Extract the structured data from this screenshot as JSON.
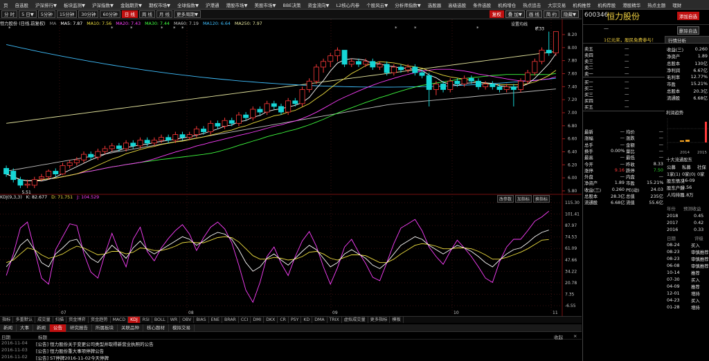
{
  "menu": [
    "页",
    "自选股",
    "沪深排行▼",
    "板块监测▼",
    "沪深指数▼",
    "金融期货▼",
    "期权市场▼",
    "全球指数▼",
    "沪港通",
    "港股市场▼",
    "美股市场▼",
    "BBE决策",
    "资金流向▼",
    "L2核心内参",
    "个股风云▼",
    "分析师指数▼",
    "选股器",
    "高级选股",
    "条件选股",
    "机构增仓",
    "热点追击",
    "大宗交易",
    "机构推荐",
    "机构荐股",
    "港股精华",
    "热点主题",
    "理财"
  ],
  "periods": [
    "分 时",
    "5 日▼",
    "5分钟",
    "15分钟",
    "30分钟",
    "60分钟",
    "日 线",
    "周 线",
    "月 线",
    "更多周期▼"
  ],
  "period_active": "日 线",
  "toolbar_right": [
    "复权",
    "叠 加▼",
    "画 线",
    "简 约",
    "隐藏▼"
  ],
  "ma_legend": {
    "name": "恒力股份 (日线,前复权)",
    "ma": "MA",
    "ma5": "MA5: 7.87",
    "ma10": "MA10: 7.56",
    "ma20": "MA20: 7.43",
    "ma30": "MA30: 7.44",
    "ma60": "MA60: 7.19",
    "ma120": "MA120: 6.64",
    "ma250": "MA250: 7.97"
  },
  "kdj_legend": {
    "name": "KDJ(9,3,3)",
    "k": "K: 82.677",
    "d": "D: 71.751",
    "j": "J: 104.529"
  },
  "kdj_buttons": [
    "改参数",
    "加指标",
    "换指标"
  ],
  "price_axis": [
    "8.20",
    "8.00",
    "7.80",
    "7.60",
    "7.40",
    "7.20",
    "7.00",
    "6.80",
    "6.60",
    "6.40",
    "6.20",
    "6.00",
    "5.80"
  ],
  "kdj_axis": [
    "115.30",
    "101.41",
    "87.97",
    "74.53",
    "61.09",
    "47.66",
    "34.22",
    "20.78",
    "7.35",
    "-6.55"
  ],
  "date_labels": [
    "07",
    "08",
    "09",
    "10",
    "11"
  ],
  "chart_labels": {
    "high": "8.33",
    "low": "5.51",
    "overlay": "设置均线",
    "star": "*"
  },
  "indicators": [
    "指标",
    "多重默认",
    "成交量",
    "扫描",
    "资金博弈",
    "资金趋势",
    "MACD",
    "KDJ",
    "RSI",
    "BOLL",
    "WR",
    "OBV",
    "BIAS",
    "ENE",
    "BRAR",
    "CCI",
    "DMI",
    "DKX",
    "CR",
    "PSY",
    "KD",
    "DMA",
    "TRIX",
    "虚拟成交量",
    "更多指标",
    "模板"
  ],
  "indicator_active": "KDJ",
  "tabs": [
    "新闻",
    "大事",
    "新闻",
    "公告",
    "研究报告",
    "所属板块",
    "关联品种",
    "核心题材",
    "模拟交易"
  ],
  "tab_active": "公告",
  "news_header": {
    "date": "日期",
    "title": "标题",
    "collapse": "收起",
    "close": "×"
  },
  "news": [
    {
      "date": "2016-11-04",
      "text": "[公告] 恒力股份关于变更公司类型并取得新营业执照的公告"
    },
    {
      "date": "2016-11-03",
      "text": "[公告] 恒力股份重大事项停牌公告"
    },
    {
      "date": "2016-11-02",
      "text": "[公告] ST停牌2016-11-02今天停牌"
    }
  ],
  "stock": {
    "code": "600346",
    "name": "恒力股份",
    "dash": "—",
    "btn_add": "添加自选",
    "btn_del": "删除自选",
    "btn_trade": "行情分析",
    "promo": "1亿元奖，股民免费参与！"
  },
  "order_book": {
    "sell": [
      "卖五",
      "卖四",
      "卖三",
      "卖二",
      "卖一"
    ],
    "buy": [
      "买一",
      "买二",
      "买三",
      "买四",
      "买五"
    ],
    "dash": "—"
  },
  "quote": [
    [
      "最新",
      "—",
      "均价",
      "—"
    ],
    [
      "涨幅",
      "—",
      "涨跌",
      "—"
    ],
    [
      "总手",
      "—",
      "金额",
      "—"
    ],
    [
      "换手",
      "0.00%",
      "量比",
      "—"
    ],
    [
      "最高",
      "—",
      "最低",
      "—"
    ],
    [
      "今开",
      "—",
      "昨收",
      "8.33"
    ],
    [
      "涨停",
      "9.16",
      "跌停",
      "7.50"
    ],
    [
      "外盘",
      "—",
      "内盘",
      "—"
    ],
    [
      "净资产",
      "1.89",
      "市盈",
      "15.21%"
    ],
    [
      "收益(三)",
      "0.260",
      "PE(动)",
      "24.03"
    ],
    [
      "总股本",
      "28.3亿",
      "总值",
      "235亿"
    ],
    [
      "流通股",
      "6.68亿",
      "流值",
      "55.6亿"
    ]
  ],
  "finance": [
    [
      "收益(三)",
      "0.260"
    ],
    [
      "净资产",
      "1.89"
    ],
    [
      "总股本",
      "130亿"
    ],
    [
      "净利润",
      "6.67亿"
    ],
    [
      "毛利率",
      "12.77%"
    ],
    [
      "市盈",
      "15.21%"
    ],
    [
      "总股本",
      "20.3亿"
    ],
    [
      "流通股",
      "6.68亿"
    ]
  ],
  "finance_extra": {
    "title": "利润趋势",
    "y1": "2014",
    "y2": "2015"
  },
  "holders_title": "十大流通股东",
  "holder_rows": [
    [
      "公募",
      "私募",
      "社保"
    ],
    [
      "1家(1)",
      "0家(0)",
      "0家"
    ],
    [
      "股东情况",
      "16-09",
      ""
    ],
    [
      "股东户数",
      "3.56",
      ""
    ],
    [
      "人均持股",
      "1.8万",
      ""
    ]
  ],
  "eps_head": [
    "年份",
    "预测收益"
  ],
  "eps": [
    [
      "2018",
      "0.45"
    ],
    [
      "2017",
      "0.42"
    ],
    [
      "2016",
      "0.33"
    ]
  ],
  "events_head": [
    "日期",
    "评级"
  ],
  "events": [
    [
      "08-24",
      "买入"
    ],
    [
      "08-23",
      "审慎推荐"
    ],
    [
      "08-23",
      "审慎推荐"
    ],
    [
      "06-08",
      "审慎推荐"
    ],
    [
      "10-14",
      "推荐"
    ],
    [
      "07-30",
      "买入"
    ],
    [
      "04-09",
      "推荐"
    ],
    [
      "12-01",
      "增持"
    ],
    [
      "04-23",
      "买入"
    ],
    [
      "01-28",
      "增持"
    ]
  ],
  "colors": {
    "up": "#ff3a3a",
    "down": "#16d6d6",
    "ma5": "#ffffff",
    "ma10": "#f0e040",
    "ma20": "#ff40ff",
    "ma30": "#40ff40",
    "ma60": "#c0c0c0",
    "ma120": "#40c0ff",
    "ma250": "#e8e8a0",
    "k": "#ffffff",
    "d": "#f0e040",
    "j": "#ff40ff"
  },
  "chart_data": {
    "type": "candlestick",
    "title": "恒力股份 (日线,前复权)",
    "ylim": [
      5.5,
      8.4
    ],
    "kdj_ylim": [
      -6.55,
      115.3
    ],
    "candles": [
      [
        5.9,
        5.8,
        5.95,
        5.75
      ],
      [
        5.85,
        5.7,
        5.9,
        5.65
      ],
      [
        5.7,
        5.6,
        5.75,
        5.55
      ],
      [
        5.6,
        5.62,
        5.7,
        5.55
      ],
      [
        5.6,
        5.7,
        5.75,
        5.55
      ],
      [
        5.72,
        5.75,
        5.8,
        5.68
      ],
      [
        5.75,
        5.85,
        5.88,
        5.7
      ],
      [
        5.85,
        5.8,
        5.9,
        5.75
      ],
      [
        5.8,
        5.95,
        6.0,
        5.78
      ],
      [
        5.95,
        6.0,
        6.05,
        5.9
      ],
      [
        6.0,
        6.05,
        6.1,
        5.95
      ],
      [
        6.05,
        6.15,
        6.2,
        6.0
      ],
      [
        6.15,
        6.1,
        6.2,
        6.05
      ],
      [
        6.1,
        6.2,
        6.25,
        6.05
      ],
      [
        6.2,
        6.25,
        6.3,
        6.15
      ],
      [
        6.25,
        6.3,
        6.35,
        6.2
      ],
      [
        6.3,
        6.25,
        6.35,
        6.2
      ],
      [
        6.25,
        6.35,
        6.4,
        6.2
      ],
      [
        6.35,
        6.3,
        6.4,
        6.25
      ],
      [
        6.3,
        6.4,
        6.45,
        6.25
      ],
      [
        6.4,
        6.35,
        6.45,
        6.3
      ],
      [
        6.35,
        6.4,
        6.45,
        6.3
      ],
      [
        6.4,
        6.45,
        6.5,
        6.35
      ],
      [
        6.45,
        6.4,
        6.5,
        6.35
      ],
      [
        6.4,
        6.5,
        6.55,
        6.35
      ],
      [
        6.5,
        6.45,
        6.55,
        6.4
      ],
      [
        6.45,
        6.5,
        6.55,
        6.4
      ],
      [
        6.5,
        6.6,
        6.65,
        6.45
      ],
      [
        6.6,
        6.55,
        6.65,
        6.5
      ],
      [
        6.55,
        6.7,
        6.75,
        6.5
      ],
      [
        6.7,
        6.65,
        6.75,
        6.6
      ],
      [
        6.65,
        6.75,
        6.8,
        6.6
      ],
      [
        6.75,
        6.7,
        6.8,
        6.65
      ],
      [
        6.7,
        6.85,
        6.9,
        6.65
      ],
      [
        6.85,
        6.8,
        6.9,
        6.75
      ],
      [
        6.8,
        6.95,
        7.0,
        6.75
      ],
      [
        6.95,
        6.9,
        7.0,
        6.85
      ],
      [
        6.9,
        7.05,
        7.1,
        6.85
      ],
      [
        7.05,
        7.0,
        7.1,
        6.95
      ],
      [
        7.0,
        6.9,
        7.05,
        6.85
      ],
      [
        6.9,
        7.1,
        7.15,
        6.85
      ],
      [
        7.1,
        7.05,
        7.15,
        7.0
      ],
      [
        7.05,
        7.3,
        7.35,
        7.0
      ],
      [
        7.3,
        7.45,
        7.5,
        7.25
      ],
      [
        7.45,
        7.7,
        7.75,
        7.4
      ],
      [
        7.7,
        7.8,
        7.85,
        7.6
      ],
      [
        7.8,
        7.9,
        7.95,
        7.7
      ],
      [
        7.9,
        8.0,
        8.05,
        7.8
      ],
      [
        8.0,
        7.75,
        8.0,
        7.7
      ],
      [
        7.75,
        7.8,
        7.85,
        7.7
      ],
      [
        7.8,
        7.75,
        7.85,
        7.7
      ],
      [
        7.75,
        7.8,
        7.85,
        7.7
      ],
      [
        7.8,
        7.7,
        7.85,
        7.65
      ],
      [
        7.7,
        7.75,
        7.8,
        7.65
      ],
      [
        7.75,
        7.6,
        7.8,
        7.55
      ],
      [
        7.6,
        7.7,
        7.75,
        7.55
      ],
      [
        7.7,
        7.65,
        7.75,
        7.6
      ],
      [
        7.65,
        7.7,
        7.75,
        7.6
      ],
      [
        7.7,
        7.6,
        7.75,
        7.55
      ],
      [
        7.6,
        7.55,
        7.65,
        7.5
      ],
      [
        7.55,
        7.3,
        7.6,
        7.0
      ],
      [
        7.3,
        7.4,
        7.45,
        7.2
      ],
      [
        7.4,
        7.3,
        7.45,
        7.25
      ],
      [
        7.3,
        7.45,
        7.5,
        7.25
      ],
      [
        7.45,
        7.4,
        7.5,
        7.35
      ],
      [
        7.4,
        7.5,
        7.55,
        7.35
      ],
      [
        7.5,
        7.45,
        7.55,
        7.4
      ],
      [
        7.45,
        7.35,
        7.5,
        7.3
      ],
      [
        7.35,
        7.4,
        7.45,
        7.3
      ],
      [
        7.4,
        7.35,
        7.45,
        7.3
      ],
      [
        7.35,
        7.3,
        7.4,
        7.25
      ],
      [
        7.3,
        7.35,
        7.4,
        7.25
      ],
      [
        7.35,
        7.3,
        7.4,
        7.0
      ],
      [
        7.3,
        7.45,
        7.5,
        7.25
      ],
      [
        7.45,
        7.6,
        7.65,
        7.4
      ],
      [
        7.6,
        7.8,
        7.85,
        7.55
      ],
      [
        7.8,
        8.0,
        8.05,
        7.75
      ],
      [
        8.0,
        7.95,
        8.33,
        7.9
      ],
      [
        7.95,
        8.33,
        8.33,
        7.9
      ]
    ],
    "kdj": {
      "k": [
        40,
        50,
        65,
        72,
        60,
        45,
        40,
        55,
        62,
        70,
        72,
        60,
        50,
        45,
        55,
        65,
        58,
        50,
        62,
        70,
        60,
        55,
        60,
        65,
        70,
        75,
        72,
        65,
        70,
        76,
        80,
        78,
        72,
        60,
        45,
        35,
        40,
        50,
        55,
        48,
        42,
        50,
        58,
        65,
        60,
        50,
        40,
        45,
        55,
        60,
        55,
        50,
        42,
        38,
        45,
        55,
        65,
        70,
        75,
        72,
        65,
        60,
        55,
        60,
        65,
        62,
        58,
        52,
        45,
        40,
        48,
        55,
        60,
        62,
        68,
        75,
        80,
        82.677
      ],
      "d": [
        45,
        48,
        55,
        62,
        60,
        54,
        50,
        52,
        55,
        60,
        64,
        62,
        58,
        54,
        55,
        58,
        58,
        55,
        57,
        62,
        61,
        59,
        59,
        61,
        64,
        68,
        69,
        68,
        68,
        71,
        74,
        75,
        74,
        69,
        61,
        53,
        49,
        49,
        51,
        50,
        48,
        49,
        52,
        57,
        58,
        55,
        50,
        48,
        51,
        54,
        54,
        53,
        49,
        45,
        45,
        49,
        55,
        60,
        65,
        67,
        66,
        64,
        61,
        61,
        62,
        62,
        61,
        58,
        54,
        49,
        49,
        51,
        54,
        57,
        61,
        66,
        71,
        71.751
      ],
      "j": [
        30,
        55,
        85,
        92,
        60,
        27,
        20,
        60,
        75,
        90,
        88,
        56,
        34,
        27,
        55,
        79,
        58,
        40,
        72,
        86,
        58,
        47,
        62,
        73,
        82,
        89,
        78,
        59,
        74,
        86,
        92,
        84,
        68,
        42,
        13,
        -1,
        22,
        52,
        63,
        44,
        30,
        52,
        70,
        81,
        64,
        40,
        20,
        39,
        63,
        72,
        57,
        44,
        28,
        24,
        45,
        67,
        85,
        90,
        95,
        82,
        63,
        52,
        43,
        58,
        71,
        62,
        52,
        40,
        27,
        22,
        46,
        63,
        72,
        72,
        82,
        93,
        98,
        104.529
      ]
    }
  }
}
